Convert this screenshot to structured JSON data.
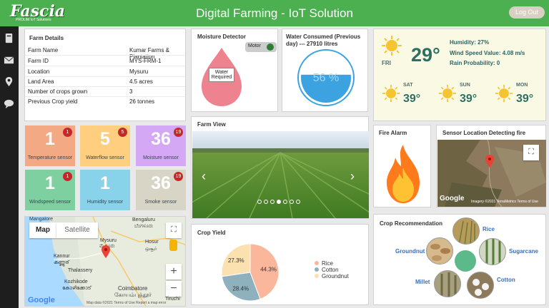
{
  "header": {
    "logo": "Fascia",
    "logo_sub": "PROLIM IoT Solutions",
    "title": "Digital Farming - IoT Solution",
    "logout": "Log Out"
  },
  "sidebar": {
    "icons": [
      "book-icon",
      "envelope-icon",
      "map-pin-icon",
      "chat-icon"
    ]
  },
  "farm": {
    "title": "Farm Details",
    "rows": [
      {
        "label": "Farm Name",
        "value": "Kumar Farms & Plantation"
      },
      {
        "label": "Farm ID",
        "value": "MYS-FRM-1"
      },
      {
        "label": "Location",
        "value": "Mysuru"
      },
      {
        "label": "Land Area",
        "value": "4.5 acres"
      },
      {
        "label": "Number of crops grown",
        "value": "3"
      },
      {
        "label": "Previous Crop yield",
        "value": "26 tonnes"
      }
    ]
  },
  "sensors": [
    {
      "count": "1",
      "label": "Temperature sensor",
      "badge": "1"
    },
    {
      "count": "5",
      "label": "Waterflow sensor",
      "badge": "5"
    },
    {
      "count": "36",
      "label": "Moisture sensor",
      "badge": "19"
    },
    {
      "count": "1",
      "label": "Windspeed sensor",
      "badge": "1"
    },
    {
      "count": "1",
      "label": "Humidity sensor",
      "badge": ""
    },
    {
      "count": "36",
      "label": "Smoke sensor",
      "badge": "19"
    }
  ],
  "moisture": {
    "title": "Moisture Detector",
    "motor": "Motor",
    "status": "Water Required"
  },
  "water": {
    "title": "Water Consumed (Previous day) --- 27910 litres",
    "percent": "56 %",
    "fill": 0.56
  },
  "weather": {
    "today": {
      "day": "FRI",
      "temp": "29°"
    },
    "humidity": "Humidity: 27%",
    "wind": "Wind Speed Value: 4.08 m/s",
    "rain": "Rain Probability: 0",
    "days": [
      {
        "day": "SAT",
        "temp": "39°"
      },
      {
        "day": "SUN",
        "temp": "39°"
      },
      {
        "day": "MON",
        "temp": "39°"
      }
    ]
  },
  "farm_view": {
    "title": "Farm View",
    "slides": 7,
    "active": 3
  },
  "fire": {
    "title": "Fire Alarm"
  },
  "fire_map": {
    "title": "Sensor Location Detecting fire",
    "attribution": "Imagery ©2021 TerraMetrics   Terms of Use",
    "google": "Google"
  },
  "map": {
    "tab_map": "Map",
    "tab_satellite": "Satellite",
    "labels": [
      "Mangalore",
      "Mysuru",
      "ಮೈಸೂರು",
      "Bengaluru",
      "ಬೆಂಗಳೂರು",
      "Kannur",
      "കണ്ണൂര്",
      "Thalassery",
      "Kozhikode",
      "കോഴിക്കോട്",
      "Coimbatore",
      "கோயம்புத்தூர்",
      "Hosur",
      "ஒசூர்",
      "Tiruchi"
    ],
    "google": "Google",
    "footer": "Map data ©2021   Terms of Use   Report a map error"
  },
  "crop_yield": {
    "title": "Crop Yield"
  },
  "chart_data": {
    "type": "pie",
    "categories": [
      "Rice",
      "Cotton",
      "Groundnut"
    ],
    "values": [
      44.3,
      28.4,
      27.3
    ],
    "colors": [
      "#fbb79b",
      "#8eb1bd",
      "#fbe0b0"
    ],
    "labels": [
      "44.3%",
      "28.4%",
      "27.3%"
    ],
    "legend": "right"
  },
  "crop_rec": {
    "title": "Crop Recommendation",
    "crops": [
      "Rice",
      "Groundnut",
      "Sugarcane",
      "Millet",
      "Cotton"
    ]
  }
}
